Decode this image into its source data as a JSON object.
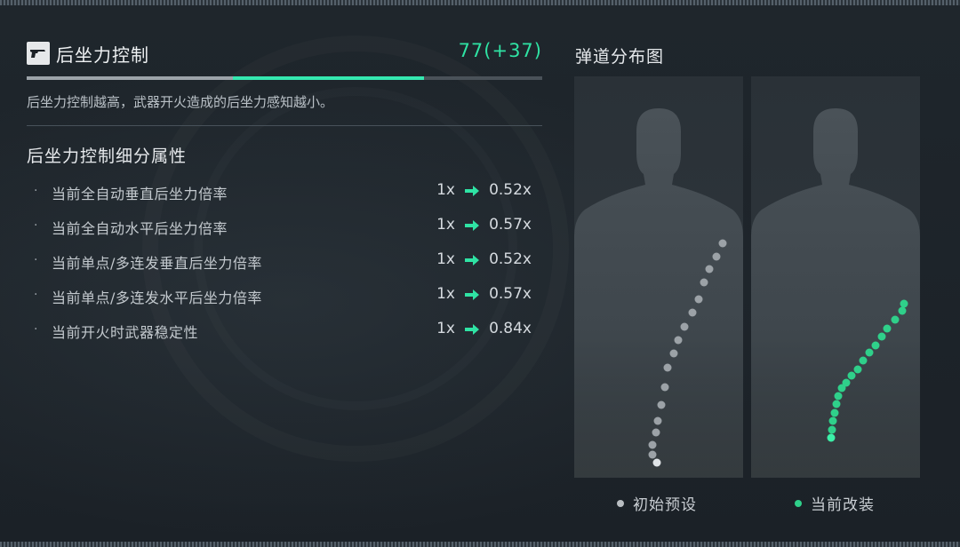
{
  "stat": {
    "icon": "pistol-icon",
    "title": "后坐力控制",
    "value": "77(+37)",
    "base_fraction": 0.4,
    "total_fraction": 0.77,
    "description": "后坐力控制越高，武器开火造成的后坐力感知越小。"
  },
  "section": {
    "title": "后坐力控制细分属性"
  },
  "attributes": [
    {
      "label": "当前全自动垂直后坐力倍率",
      "from": "1x",
      "to": "0.52x"
    },
    {
      "label": "当前全自动水平后坐力倍率",
      "from": "1x",
      "to": "0.57x"
    },
    {
      "label": "当前单点/多连发垂直后坐力倍率",
      "from": "1x",
      "to": "0.52x"
    },
    {
      "label": "当前单点/多连发水平后坐力倍率",
      "from": "1x",
      "to": "0.57x"
    },
    {
      "label": "当前开火时武器稳定性",
      "from": "1x",
      "to": "0.84x"
    }
  ],
  "ballistics": {
    "title": "弹道分布图",
    "legend": {
      "initial": "初始预设",
      "current": "当前改装"
    },
    "colors": {
      "initial": "#b9bec2",
      "current": "#2fd08a",
      "accent": "#2fe3a4",
      "arrow": "#2fe3a4"
    }
  }
}
